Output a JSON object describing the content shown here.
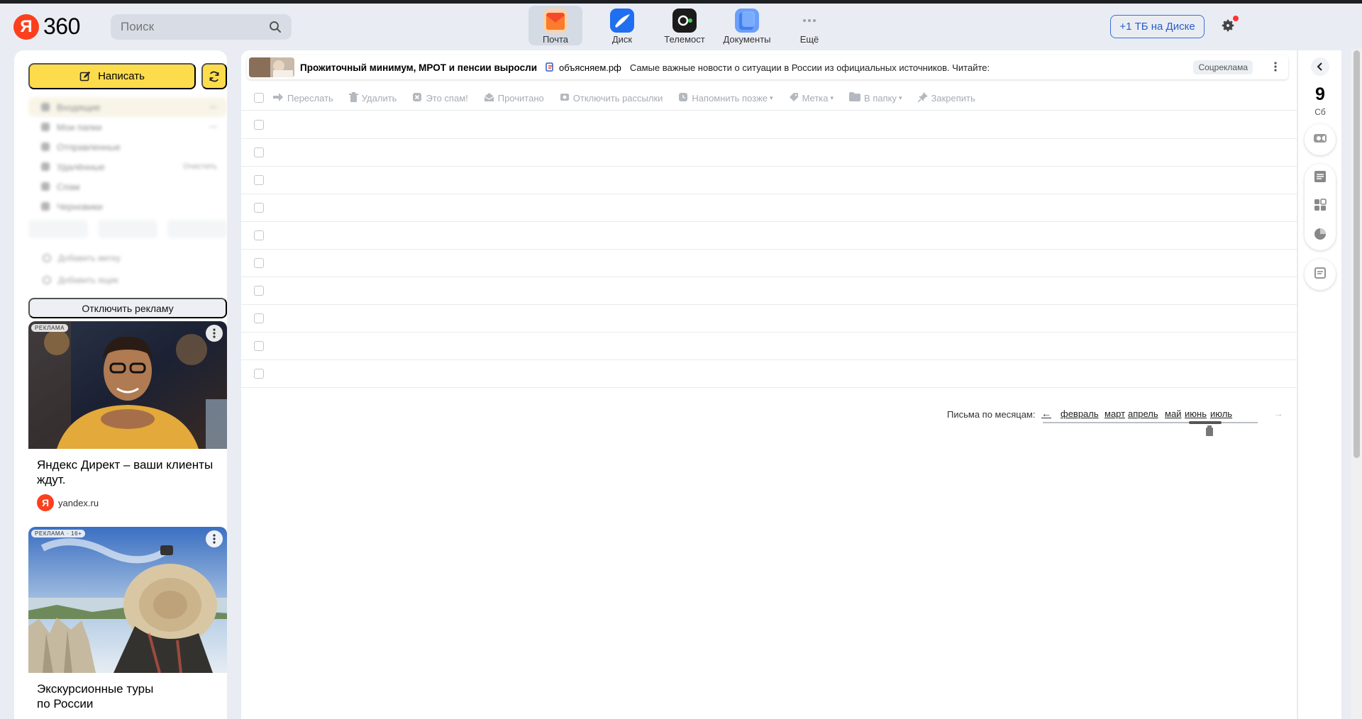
{
  "header": {
    "logo_letter": "Я",
    "logo_text": "360",
    "search_placeholder": "Поиск",
    "apps": [
      {
        "label": "Почта",
        "icon": "mail-icon",
        "color": "#fc7b2c"
      },
      {
        "label": "Диск",
        "icon": "disk-icon",
        "color": "#1f6ff0"
      },
      {
        "label": "Телемост",
        "icon": "telemost-icon",
        "color": "#1b1b1b"
      },
      {
        "label": "Документы",
        "icon": "documents-icon",
        "color": "#3f7ff0"
      },
      {
        "label": "Ещё",
        "icon": "more-dots-icon",
        "color": "#9aa0a8"
      }
    ],
    "disk_button": "+1 ТБ на Диске"
  },
  "sidebar": {
    "compose_label": "Написать",
    "folders": [
      {
        "label": "Входящие",
        "count": "—"
      },
      {
        "label": "Мои папки",
        "count": "—"
      },
      {
        "label": "Отправленные",
        "count": ""
      },
      {
        "label": "Удалённые",
        "count": "Очистить"
      },
      {
        "label": "Спам",
        "count": ""
      },
      {
        "label": "Черновики",
        "count": ""
      }
    ],
    "extras": [
      "Добавить метку",
      "Добавить ящик"
    ],
    "disable_ads_label": "Отключить рекламу",
    "ads": [
      {
        "badge": "РЕКЛАМА",
        "title": "Яндекс Директ – ваши клиенты ждут.",
        "source": "yandex.ru"
      },
      {
        "badge": "РЕКЛАМА · 16+",
        "title": "Экскурсионные туры по России",
        "source": ""
      }
    ]
  },
  "banner": {
    "title": "Прожиточный минимум, МРОТ и пенсии выросли",
    "source": "объясняем.рф",
    "description": "Самые важные новости о ситуации в России из официальных источников. Читайте:",
    "tag": "Соцреклама"
  },
  "toolbar": [
    {
      "label": "Переслать",
      "icon": "forward-icon",
      "caret": ""
    },
    {
      "label": "Удалить",
      "icon": "trash-icon",
      "caret": ""
    },
    {
      "label": "Это спам!",
      "icon": "spam-icon",
      "caret": ""
    },
    {
      "label": "Прочитано",
      "icon": "read-envelope-icon",
      "caret": ""
    },
    {
      "label": "Отключить рассылки",
      "icon": "unsubscribe-icon",
      "caret": ""
    },
    {
      "label": "Напомнить позже",
      "icon": "remind-icon",
      "caret": "▾"
    },
    {
      "label": "Метка",
      "icon": "tag-icon",
      "caret": "▾"
    },
    {
      "label": "В папку",
      "icon": "folder-icon",
      "caret": "▾"
    },
    {
      "label": "Закрепить",
      "icon": "pin-icon",
      "caret": ""
    }
  ],
  "message_rows": 10,
  "months": {
    "label": "Письма по месяцам:",
    "prev_arrow": "←",
    "next_arrow": "→",
    "items": [
      "февраль",
      "март",
      "апрель",
      "май",
      "июнь",
      "июль"
    ],
    "active": "июль"
  },
  "rail": {
    "date": "9",
    "day": "Сб"
  },
  "colors": {
    "accent_yellow": "#fddc4c",
    "brand_red": "#fc3f1d",
    "link_blue": "#2a5cc7"
  }
}
